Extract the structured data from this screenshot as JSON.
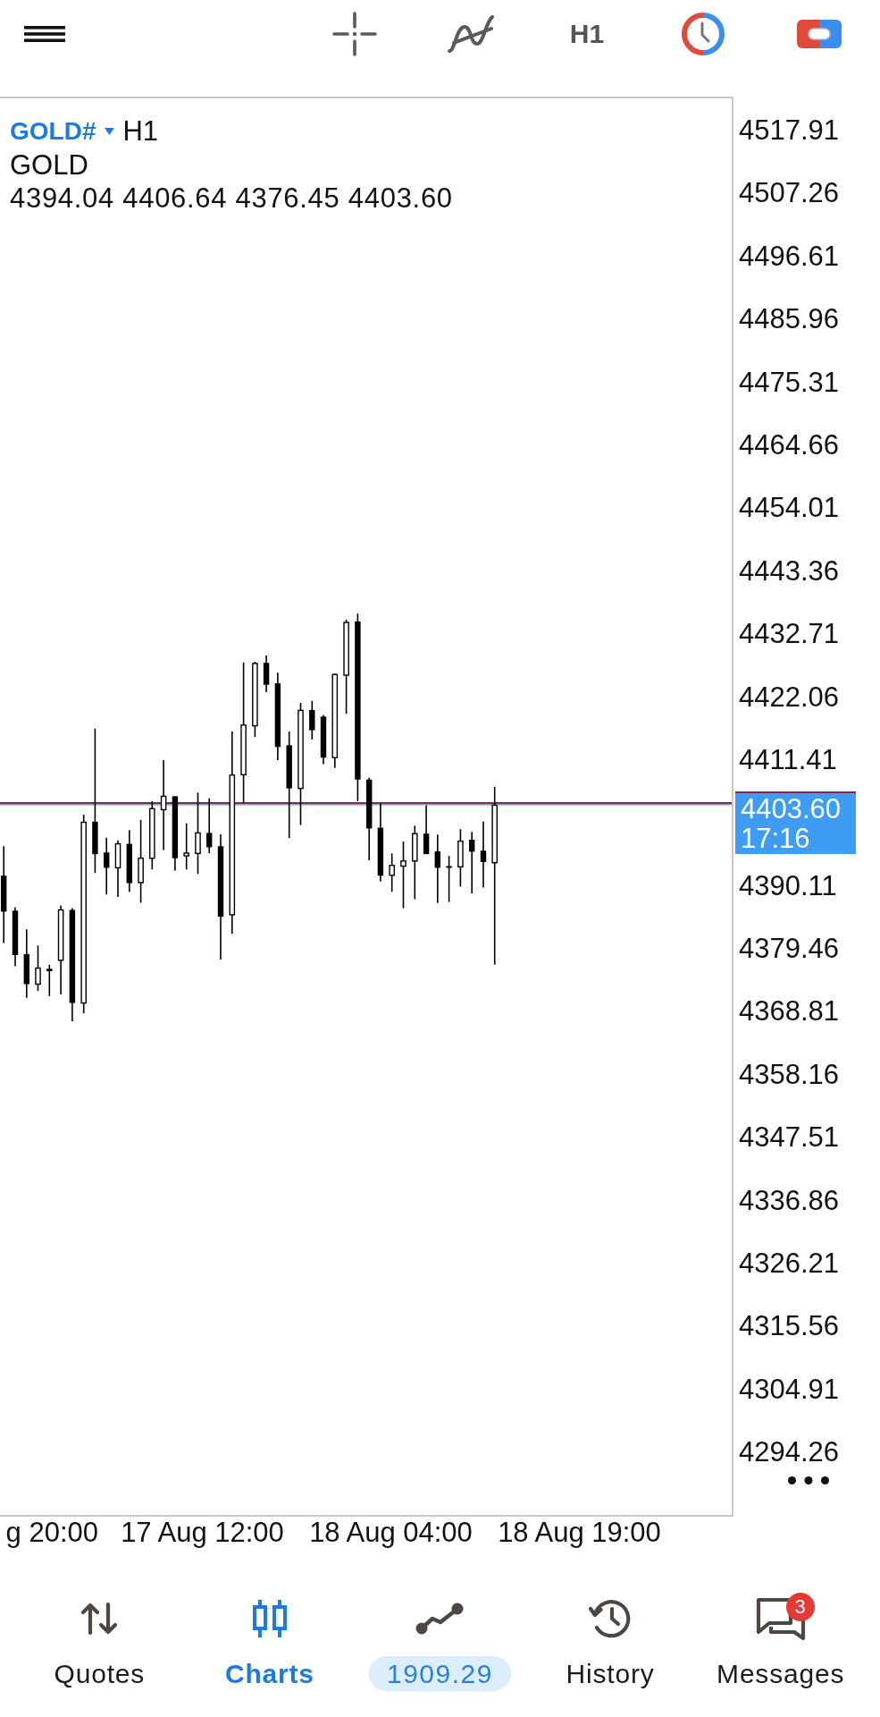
{
  "toolbar": {
    "timeframe": "H1"
  },
  "chart": {
    "symbol": "GOLD#",
    "timeframe": "H1",
    "description": "GOLD",
    "ohlc": "4394.04 4406.64 4376.45 4403.60",
    "price_axis": [
      {
        "kind": "label",
        "text": "4517.91"
      },
      {
        "kind": "label",
        "text": "4507.26"
      },
      {
        "kind": "label",
        "text": "4496.61"
      },
      {
        "kind": "label",
        "text": "4485.96"
      },
      {
        "kind": "label",
        "text": "4475.31"
      },
      {
        "kind": "label",
        "text": "4464.66"
      },
      {
        "kind": "label",
        "text": "4454.01"
      },
      {
        "kind": "label",
        "text": "4443.36"
      },
      {
        "kind": "label",
        "text": "4432.71"
      },
      {
        "kind": "label",
        "text": "4422.06"
      },
      {
        "kind": "label",
        "text": "4411.41"
      },
      {
        "kind": "current",
        "price": "4403.60",
        "time": "17:16"
      },
      {
        "kind": "label",
        "text": "4390.11"
      },
      {
        "kind": "label",
        "text": "4379.46"
      },
      {
        "kind": "label",
        "text": "4368.81"
      },
      {
        "kind": "label",
        "text": "4358.16"
      },
      {
        "kind": "label",
        "text": "4347.51"
      },
      {
        "kind": "label",
        "text": "4336.86"
      },
      {
        "kind": "label",
        "text": "4326.21"
      },
      {
        "kind": "label",
        "text": "4315.56"
      },
      {
        "kind": "label",
        "text": "4304.91"
      },
      {
        "kind": "label",
        "text": "4294.26"
      }
    ],
    "time_axis": [
      "g 20:00",
      "17 Aug 12:00",
      "18 Aug 04:00",
      "18 Aug 19:00"
    ]
  },
  "bottom_nav": [
    {
      "kind": "tab",
      "label": "Quotes",
      "selected": false
    },
    {
      "kind": "tab",
      "label": "Charts",
      "selected": true
    },
    {
      "kind": "balance",
      "label": "1909.29",
      "selected": false
    },
    {
      "kind": "tab",
      "label": "History",
      "selected": false
    },
    {
      "kind": "tab",
      "label": "Messages",
      "selected": false,
      "badge": "3"
    }
  ]
}
